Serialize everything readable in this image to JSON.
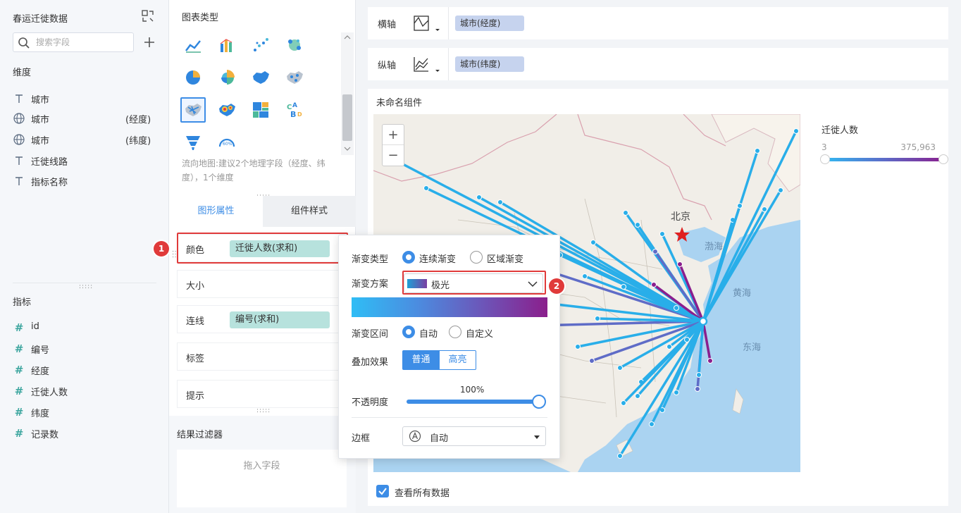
{
  "left_panel": {
    "dataset_title": "春运迁徙数据",
    "search_placeholder": "搜索字段",
    "dimensions_title": "维度",
    "dimensions": [
      {
        "name": "城市",
        "suffix": "",
        "icon": "text-field-icon"
      },
      {
        "name": "城市",
        "suffix": "(经度)",
        "icon": "globe-icon"
      },
      {
        "name": "城市",
        "suffix": "(纬度)",
        "icon": "globe-icon"
      },
      {
        "name": "迁徙线路",
        "suffix": "",
        "icon": "text-field-icon"
      },
      {
        "name": "指标名称",
        "suffix": "",
        "icon": "text-field-icon"
      }
    ],
    "measures_title": "指标",
    "measures": [
      {
        "name": "id",
        "icon": "number-field-icon"
      },
      {
        "name": "编号",
        "icon": "number-field-icon"
      },
      {
        "name": "经度",
        "icon": "number-field-icon"
      },
      {
        "name": "迁徙人数",
        "icon": "number-field-icon"
      },
      {
        "name": "纬度",
        "icon": "number-field-icon"
      },
      {
        "name": "记录数",
        "icon": "number-field-icon"
      }
    ]
  },
  "chart_panel": {
    "title": "图表类型",
    "hint": "流向地图:建议2个地理字段（经度、纬度），1个维度",
    "tabs": [
      "图形属性",
      "组件样式"
    ],
    "props": [
      {
        "label": "颜色",
        "pill": "迁徙人数(求和)"
      },
      {
        "label": "大小",
        "pill": ""
      },
      {
        "label": "连线",
        "pill": "编号(求和)"
      },
      {
        "label": "标签",
        "pill": ""
      },
      {
        "label": "提示",
        "pill": ""
      }
    ],
    "filter_title": "结果过滤器",
    "drop_hint": "拖入字段"
  },
  "axes": {
    "x_label": "横轴",
    "x_field": "城市(经度)",
    "y_label": "纵轴",
    "y_field": "城市(纬度)"
  },
  "widget": {
    "title": "未命名组件",
    "legend_title": "迁徙人数",
    "legend_min": "3",
    "legend_max": "375,963",
    "show_all_label": "查看所有数据",
    "map_labels": {
      "beijing": "北京",
      "bohai": "渤海",
      "huanghai": "黄海",
      "donghai": "东海"
    }
  },
  "popup": {
    "gradient_type_label": "渐变类型",
    "gradient_type_options": [
      "连续渐变",
      "区域渐变"
    ],
    "gradient_scheme_label": "渐变方案",
    "gradient_scheme_value": "极光",
    "gradient_range_label": "渐变区间",
    "gradient_range_options": [
      "自动",
      "自定义"
    ],
    "overlay_label": "叠加效果",
    "overlay_options": [
      "普通",
      "高亮"
    ],
    "opacity_label": "不透明度",
    "opacity_value": "100%",
    "border_label": "边框",
    "border_value": "自动"
  },
  "annotations": [
    "1",
    "2"
  ],
  "colors": {
    "accent": "#3d8de6",
    "highlight": "#e03a3a",
    "pill_green": "#b7e2dd",
    "pill_blue": "#c6d3ee"
  }
}
